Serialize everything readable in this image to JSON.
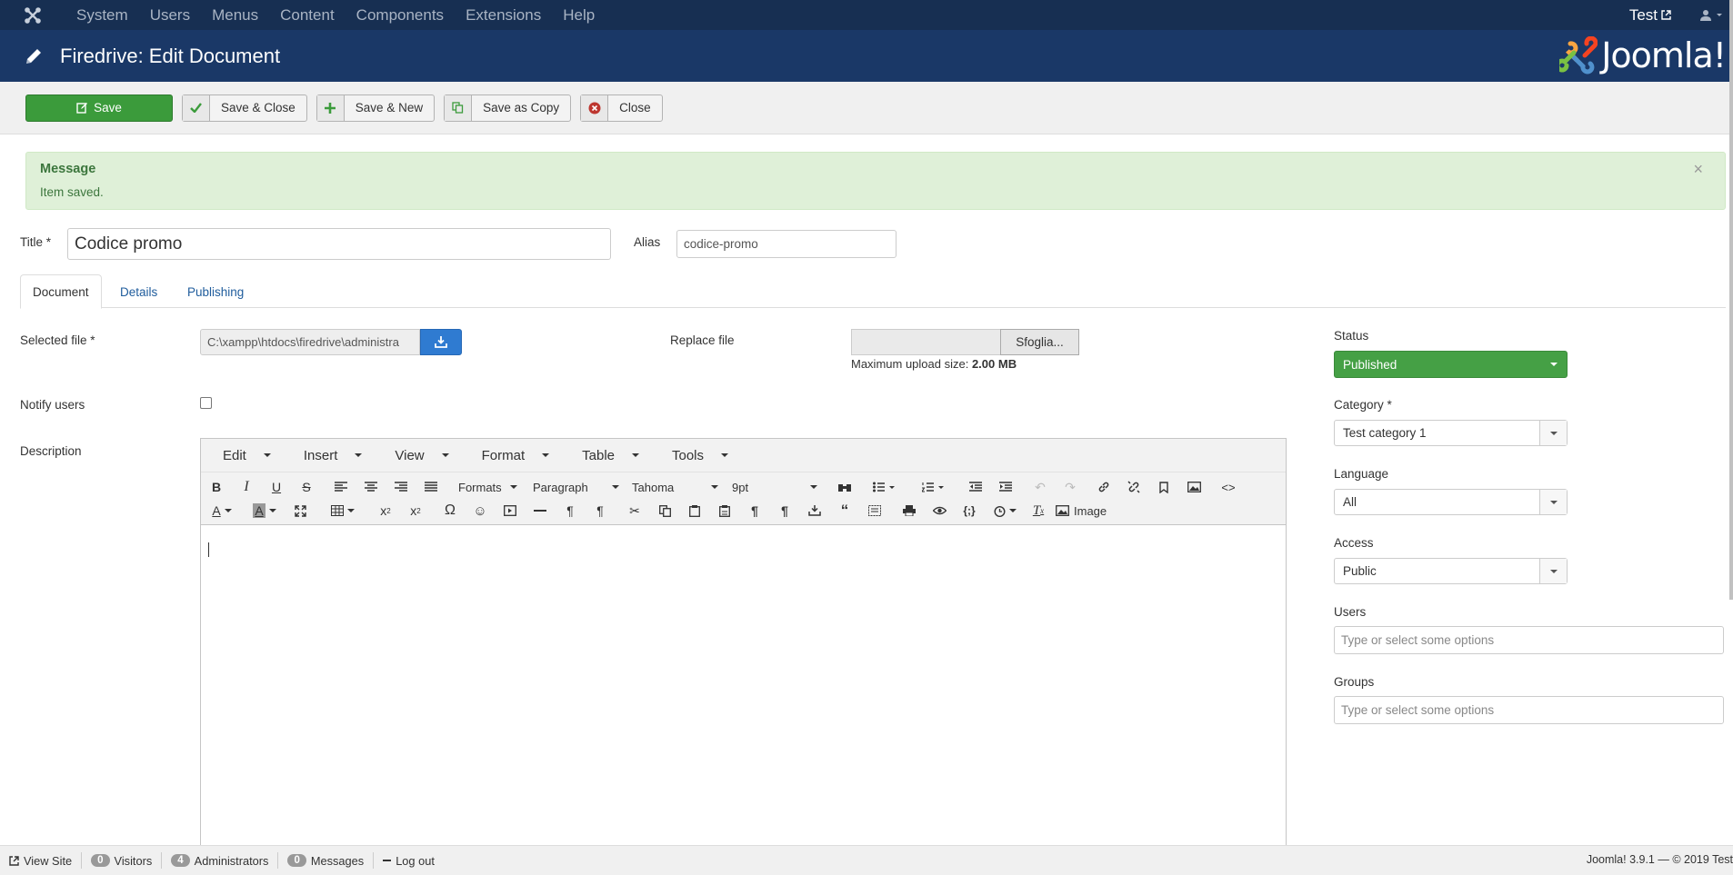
{
  "topnav": {
    "menu": [
      "System",
      "Users",
      "Menus",
      "Content",
      "Components",
      "Extensions",
      "Help"
    ],
    "site_name": "Test"
  },
  "header": {
    "title": "Firedrive: Edit Document",
    "brand": "Joomla!"
  },
  "toolbar": {
    "save_label": "Save",
    "save_close_label": "Save & Close",
    "save_new_label": "Save & New",
    "save_copy_label": "Save as Copy",
    "close_label": "Close"
  },
  "message": {
    "heading": "Message",
    "text": "Item saved."
  },
  "form": {
    "title_label": "Title *",
    "title_value": "Codice promo",
    "alias_label": "Alias",
    "alias_value": "codice-promo"
  },
  "tabs": [
    "Document",
    "Details",
    "Publishing"
  ],
  "document": {
    "selected_file_label": "Selected file *",
    "selected_file_value": "C:\\xampp\\htdocs\\firedrive\\administra",
    "replace_file_label": "Replace file",
    "browse_label": "Sfoglia...",
    "max_upload_label": "Maximum upload size:",
    "max_upload_value": "2.00 MB",
    "notify_label": "Notify users",
    "description_label": "Description"
  },
  "editor": {
    "menus": [
      "Edit",
      "Insert",
      "View",
      "Format",
      "Table",
      "Tools"
    ],
    "formats_label": "Formats",
    "block_label": "Paragraph",
    "font_label": "Tahoma",
    "size_label": "9pt",
    "image_label": "Image"
  },
  "sidebar": {
    "status_label": "Status",
    "status_value": "Published",
    "category_label": "Category *",
    "category_value": "Test category 1",
    "language_label": "Language",
    "language_value": "All",
    "access_label": "Access",
    "access_value": "Public",
    "users_label": "Users",
    "users_placeholder": "Type or select some options",
    "groups_label": "Groups",
    "groups_placeholder": "Type or select some options"
  },
  "statusbar": {
    "view_site": "View Site",
    "visitors_count": "0",
    "visitors_label": "Visitors",
    "admins_count": "4",
    "admins_label": "Administrators",
    "messages_count": "0",
    "messages_label": "Messages",
    "logout_label": "Log out",
    "version": "Joomla! 3.9.1 — © 2019 Test"
  },
  "colors": {
    "topnav": "#172f52",
    "header": "#1a3867",
    "save_green": "#3b9b3b",
    "status_green": "#45a045",
    "upload_blue": "#2f7bd1",
    "message_bg": "#dff0d8"
  }
}
